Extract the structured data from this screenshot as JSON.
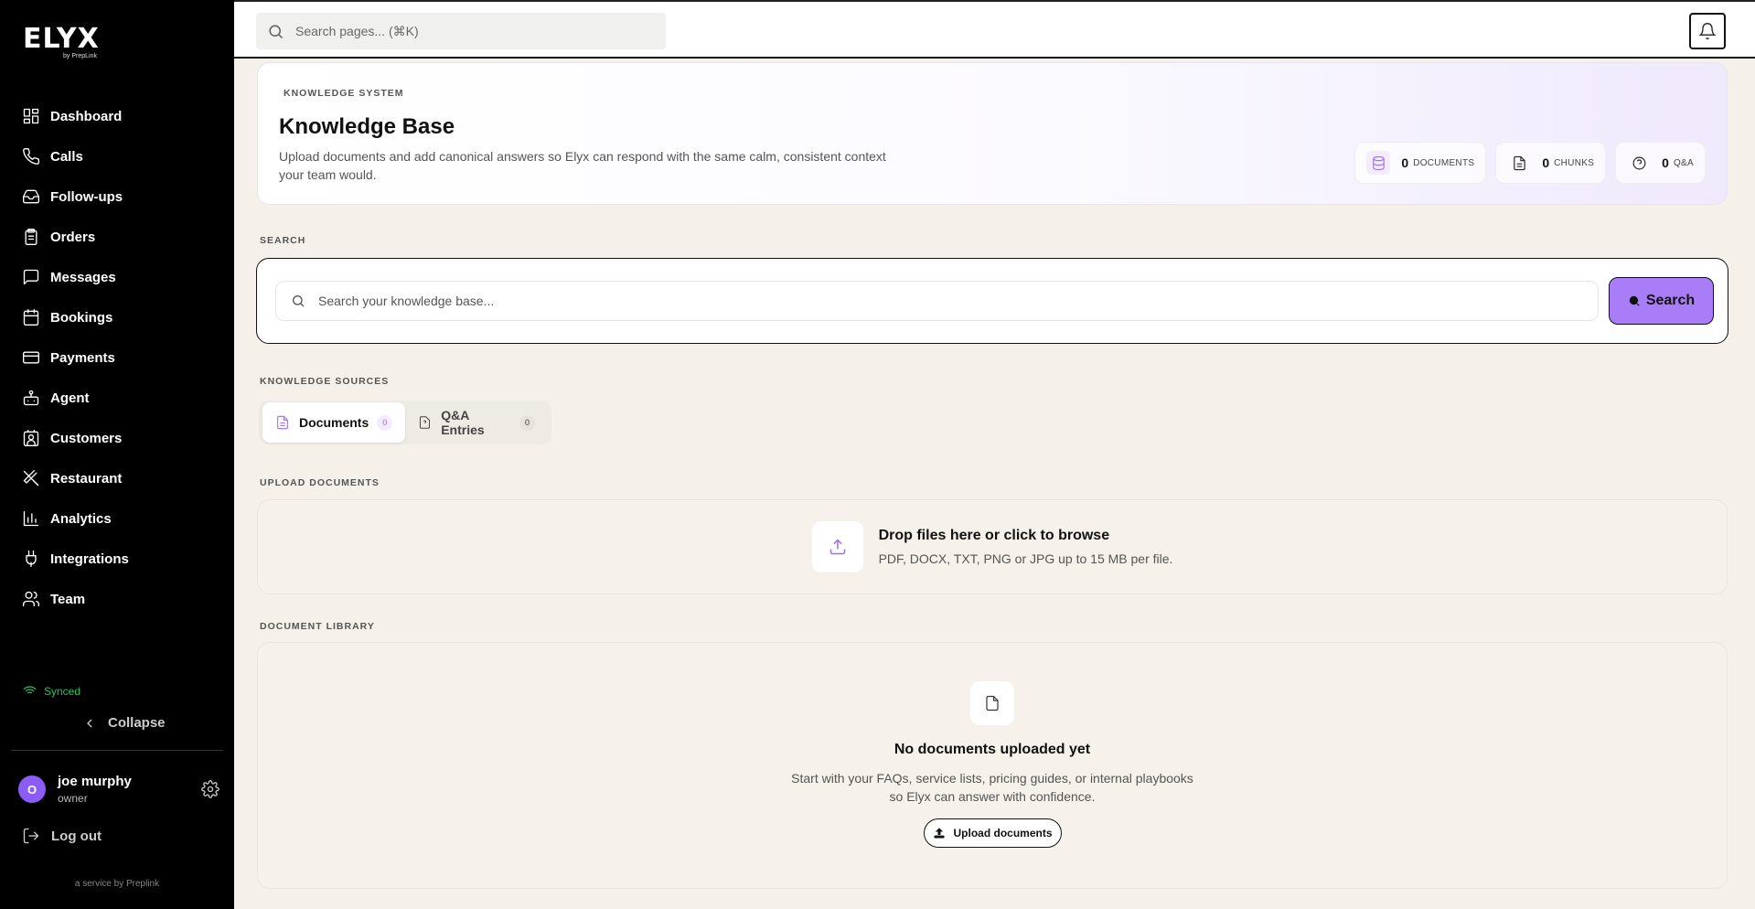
{
  "brand": {
    "name": "ELYX",
    "byline": "by PrepLink"
  },
  "sidebar": {
    "items": [
      {
        "label": "Dashboard",
        "icon": "grid-icon"
      },
      {
        "label": "Calls",
        "icon": "phone-icon"
      },
      {
        "label": "Follow-ups",
        "icon": "inbox-icon"
      },
      {
        "label": "Orders",
        "icon": "clipboard-icon"
      },
      {
        "label": "Messages",
        "icon": "message-icon"
      },
      {
        "label": "Bookings",
        "icon": "calendar-icon"
      },
      {
        "label": "Payments",
        "icon": "credit-card-icon"
      },
      {
        "label": "Agent",
        "icon": "bot-icon"
      },
      {
        "label": "Customers",
        "icon": "contact-icon"
      },
      {
        "label": "Restaurant",
        "icon": "utensils-icon"
      },
      {
        "label": "Analytics",
        "icon": "bar-chart-icon"
      },
      {
        "label": "Integrations",
        "icon": "plug-icon"
      },
      {
        "label": "Team",
        "icon": "users-icon"
      }
    ],
    "sync_status": "Synced",
    "collapse_label": "Collapse",
    "user": {
      "initial": "O",
      "name": "joe murphy",
      "role": "owner"
    },
    "logout_label": "Log out",
    "footer": "a service by Preplink"
  },
  "topbar": {
    "search_placeholder": "Search pages... (⌘K)"
  },
  "hero": {
    "eyebrow": "KNOWLEDGE SYSTEM",
    "title": "Knowledge Base",
    "description": "Upload documents and add canonical answers so Elyx can respond with the same calm, consistent context your team would.",
    "stats": [
      {
        "value": "0",
        "label": "DOCUMENTS",
        "icon": "database-icon"
      },
      {
        "value": "0",
        "label": "CHUNKS",
        "icon": "file-text-icon"
      },
      {
        "value": "0",
        "label": "Q&A",
        "icon": "help-circle-icon"
      }
    ]
  },
  "search": {
    "section_label": "SEARCH",
    "placeholder": "Search your knowledge base...",
    "button_label": "Search"
  },
  "sources": {
    "section_label": "KNOWLEDGE SOURCES",
    "tabs": [
      {
        "label": "Documents",
        "count": "0",
        "active": true
      },
      {
        "label": "Q&A Entries",
        "count": "0",
        "active": false
      }
    ]
  },
  "upload": {
    "section_label": "UPLOAD DOCUMENTS",
    "title": "Drop files here or click to browse",
    "subtitle": "PDF, DOCX, TXT, PNG or JPG up to 15 MB per file."
  },
  "library": {
    "section_label": "DOCUMENT LIBRARY",
    "empty_title": "No documents uploaded yet",
    "empty_line1": "Start with your FAQs, service lists, pricing guides, or internal playbooks",
    "empty_line2": "so Elyx can answer with confidence.",
    "button_label": "Upload documents"
  },
  "colors": {
    "accent": "#a97df7",
    "sidebar_bg": "#000000",
    "page_bg": "#f5f0ea",
    "synced": "#22c55e"
  }
}
